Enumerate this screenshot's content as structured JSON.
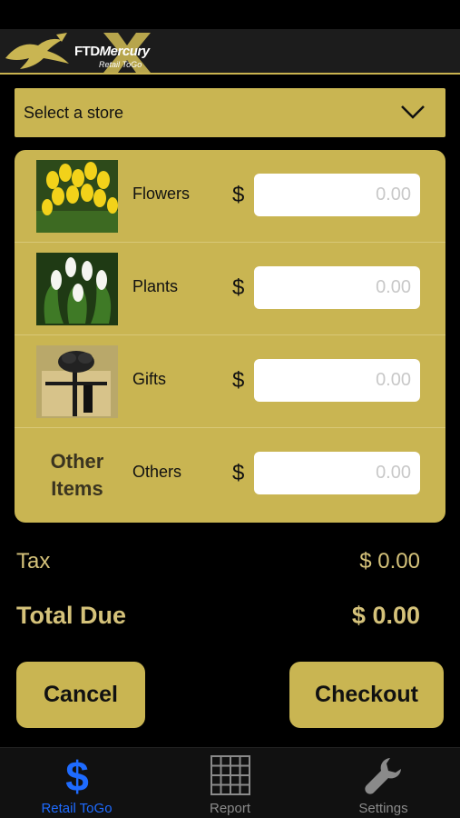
{
  "header": {
    "brand_part1": "FTD",
    "brand_part2": "Mercury",
    "subtitle": "Retail ToGo"
  },
  "store_select": {
    "placeholder": "Select a store",
    "icon": "chevron-down-icon"
  },
  "categories": [
    {
      "label": "Flowers",
      "currency": "$",
      "placeholder": "0.00"
    },
    {
      "label": "Plants",
      "currency": "$",
      "placeholder": "0.00"
    },
    {
      "label": "Gifts",
      "currency": "$",
      "placeholder": "0.00"
    },
    {
      "label": "Others",
      "currency": "$",
      "placeholder": "0.00",
      "thumb_text_line1": "Other",
      "thumb_text_line2": "Items"
    }
  ],
  "summary": {
    "tax_label": "Tax",
    "tax_value": "$ 0.00",
    "total_label": "Total Due",
    "total_value": "$ 0.00"
  },
  "actions": {
    "cancel_label": "Cancel",
    "checkout_label": "Checkout"
  },
  "tabs": [
    {
      "label": "Retail ToGo",
      "icon": "dollar-icon",
      "active": true
    },
    {
      "label": "Report",
      "icon": "grid-icon",
      "active": false
    },
    {
      "label": "Settings",
      "icon": "wrench-icon",
      "active": false
    }
  ],
  "colors": {
    "accent": "#c9b552",
    "text_gold": "#d5c27a",
    "active_tab": "#1e6bff"
  }
}
